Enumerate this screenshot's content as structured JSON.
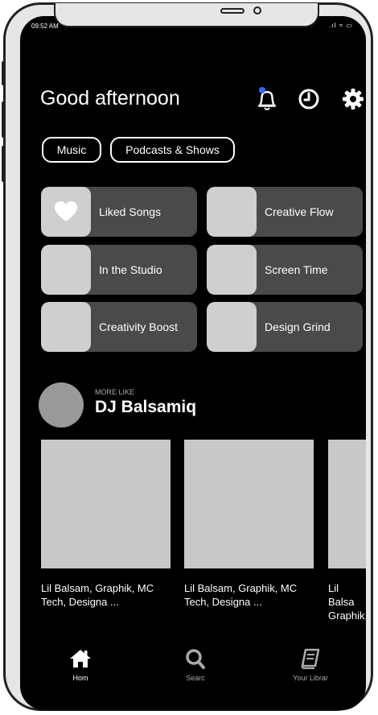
{
  "status_bar": {
    "time": "09:52 AM",
    "icons": ".ıl ≈ ▭"
  },
  "header": {
    "greeting": "Good afternoon"
  },
  "chips": [
    "Music",
    "Podcasts & Shows"
  ],
  "tiles": [
    {
      "label": "Liked Songs",
      "icon": "heart-icon"
    },
    {
      "label": "Creative Flow"
    },
    {
      "label": "In the Studio"
    },
    {
      "label": "Screen Time"
    },
    {
      "label": "Creativity Boost"
    },
    {
      "label": "Design Grind"
    }
  ],
  "section": {
    "more_like": "MORE LIKE",
    "artist": "DJ Balsamiq"
  },
  "cards": [
    {
      "text": "Lil Balsam, Graphik, MC\nTech, Designa ..."
    },
    {
      "text": "Lil Balsam, Graphik, MC\nTech, Designa ..."
    },
    {
      "text": "Lil Balsa\nGraphik,\nDesigna"
    }
  ],
  "nav": [
    {
      "label": "Hom",
      "icon": "home-icon"
    },
    {
      "label": "Searc",
      "icon": "search-icon"
    },
    {
      "label": "Your Librar",
      "icon": "library-icon"
    }
  ],
  "colors": {
    "background": "#000000",
    "tile": "#4a4a4a",
    "thumb": "#cfcfcf",
    "notification_dot": "#2a6df4"
  }
}
